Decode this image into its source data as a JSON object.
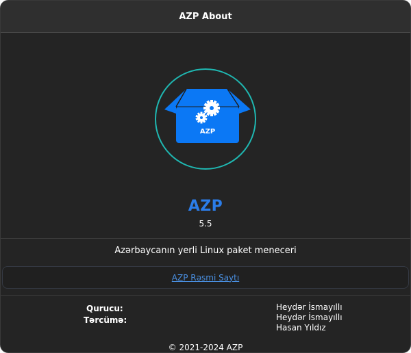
{
  "window": {
    "title": "AZP About"
  },
  "app": {
    "logo_text": "AZP",
    "name": "AZP",
    "version": "5.5",
    "description": "Azərbaycanın yerli Linux paket meneceri",
    "website_link": "AZP Rəsmi Saytı"
  },
  "credits": {
    "founder_label": "Qurucu:",
    "translator_label": "Tərcümə:",
    "names": [
      "Heydər İsmayıllı",
      "Heydər İsmayıllı",
      "Hasan Yıldız"
    ]
  },
  "footer": {
    "copyright": "© 2021-2024 AZP"
  },
  "colors": {
    "accent": "#2b7de9",
    "logo_blue": "#0b78f5",
    "ring": "#1fb8b2",
    "link": "#4a90e2",
    "background": "#242424"
  },
  "icons": {
    "logo": "package-box-gears-icon"
  }
}
